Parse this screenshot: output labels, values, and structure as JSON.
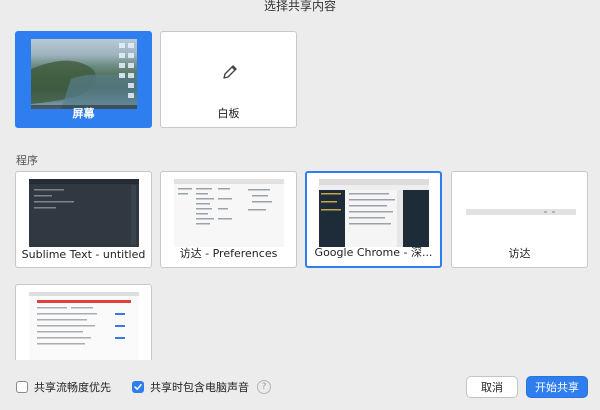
{
  "window": {
    "title": "选择共享内容"
  },
  "top_tiles": [
    {
      "label": "屏幕"
    },
    {
      "label": "白板"
    }
  ],
  "section": {
    "label": "程序"
  },
  "app_tiles": [
    {
      "label": "Sublime Text - untitled"
    },
    {
      "label": "访达 - Preferences"
    },
    {
      "label": "Google Chrome - 深..."
    },
    {
      "label": "访达"
    },
    {
      "label": ""
    }
  ],
  "footer": {
    "optimize_label": "共享流畅度优先",
    "optimize_checked": false,
    "audio_label": "共享时包含电脑声音",
    "audio_checked": true,
    "help_glyph": "?",
    "cancel_label": "取消",
    "start_label": "开始共享"
  },
  "colors": {
    "accent": "#2f7ef0",
    "background": "#ececec"
  },
  "icons": [
    "pencil-icon",
    "help-icon",
    "checkmark-icon"
  ]
}
